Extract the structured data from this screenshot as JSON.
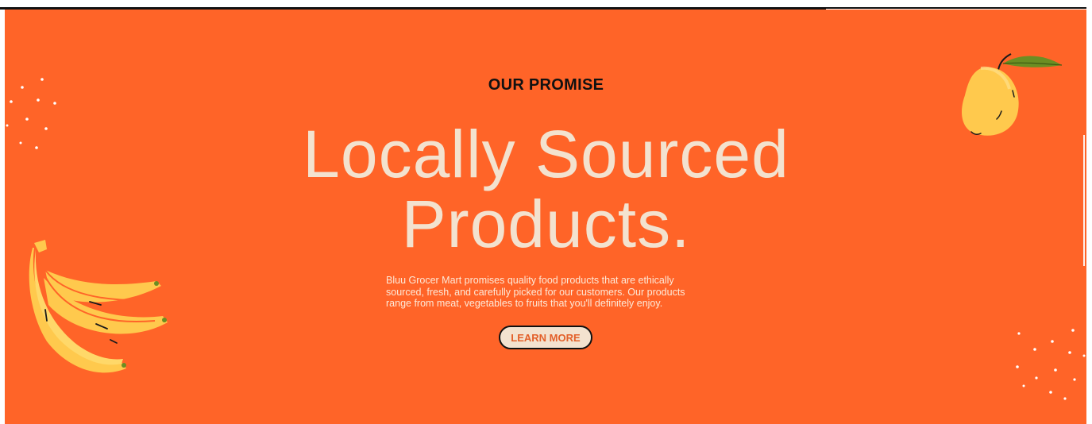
{
  "hero": {
    "eyebrow": "OUR PROMISE",
    "headline_line1": "Locally Sourced",
    "headline_line2": "Products.",
    "description": "Bluu Grocer Mart promises quality food products that are ethically sourced, fresh, and carefully picked for our customers. Our products range from meat, vegetables to fruits that you'll definitely enjoy.",
    "cta_label": "LEARN MORE"
  },
  "colors": {
    "background": "#ff6428",
    "headline": "#f3e2cf",
    "eyebrow": "#111111",
    "button_fill": "#f3e2cf",
    "button_text": "#e3602a",
    "fruit_yellow": "#ffc94d",
    "leaf_green": "#6b8e23"
  },
  "decorations": {
    "left_top": "sparkle-dots",
    "left_bottom": "banana-bunch",
    "right_top": "mango",
    "right_bottom": "sparkle-dots"
  }
}
